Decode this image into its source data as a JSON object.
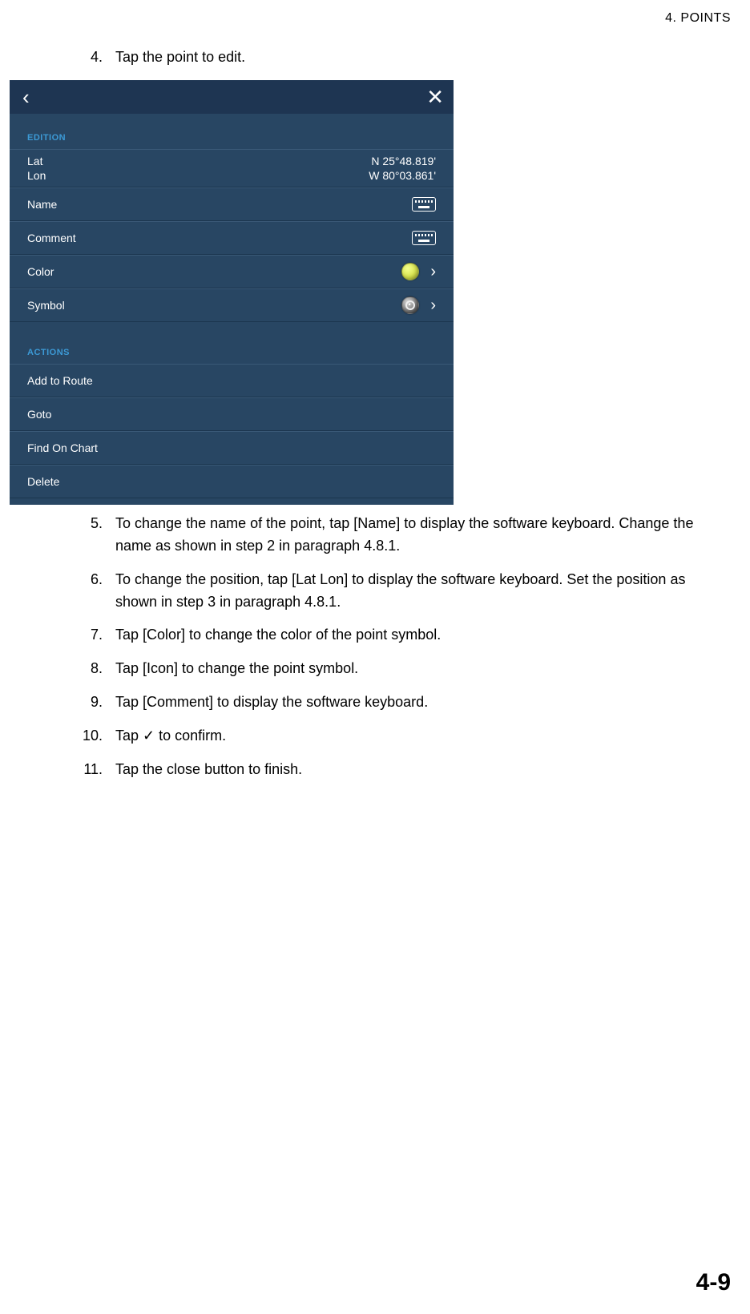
{
  "header": {
    "running_head": "4.  POINTS"
  },
  "steps_top": [
    {
      "num": "4.",
      "text": "Tap the point to edit."
    }
  ],
  "shot": {
    "back_glyph": "‹",
    "close_glyph": "✕",
    "sections": {
      "edition_label": "EDITION",
      "actions_label": "ACTIONS"
    },
    "rows": {
      "latlon": {
        "lat_label": "Lat",
        "lon_label": "Lon",
        "lat_value": "N 25°48.819'",
        "lon_value": "W 80°03.861'"
      },
      "name_label": "Name",
      "comment_label": "Comment",
      "color_label": "Color",
      "symbol_label": "Symbol",
      "chevron": "›"
    },
    "actions": {
      "add_to_route": "Add to Route",
      "goto": "Goto",
      "find_on_chart": "Find On Chart",
      "delete": "Delete"
    }
  },
  "steps_bottom": [
    {
      "num": "5.",
      "text": "To change the name of the point, tap [Name] to display the software keyboard. Change the name as shown in step 2 in paragraph 4.8.1."
    },
    {
      "num": "6.",
      "text": "To change the position, tap [Lat Lon] to display the software keyboard. Set the position as shown in step 3 in paragraph 4.8.1."
    },
    {
      "num": "7.",
      "text": "Tap [Color] to change the color of the point symbol."
    },
    {
      "num": "8.",
      "text": "Tap [Icon] to change the point symbol."
    },
    {
      "num": "9.",
      "text": "Tap [Comment] to display the software keyboard."
    },
    {
      "num": "10.",
      "text": "Tap ✓ to confirm."
    },
    {
      "num": "11.",
      "text": "Tap the close button to finish."
    }
  ],
  "page_number": "4-9"
}
